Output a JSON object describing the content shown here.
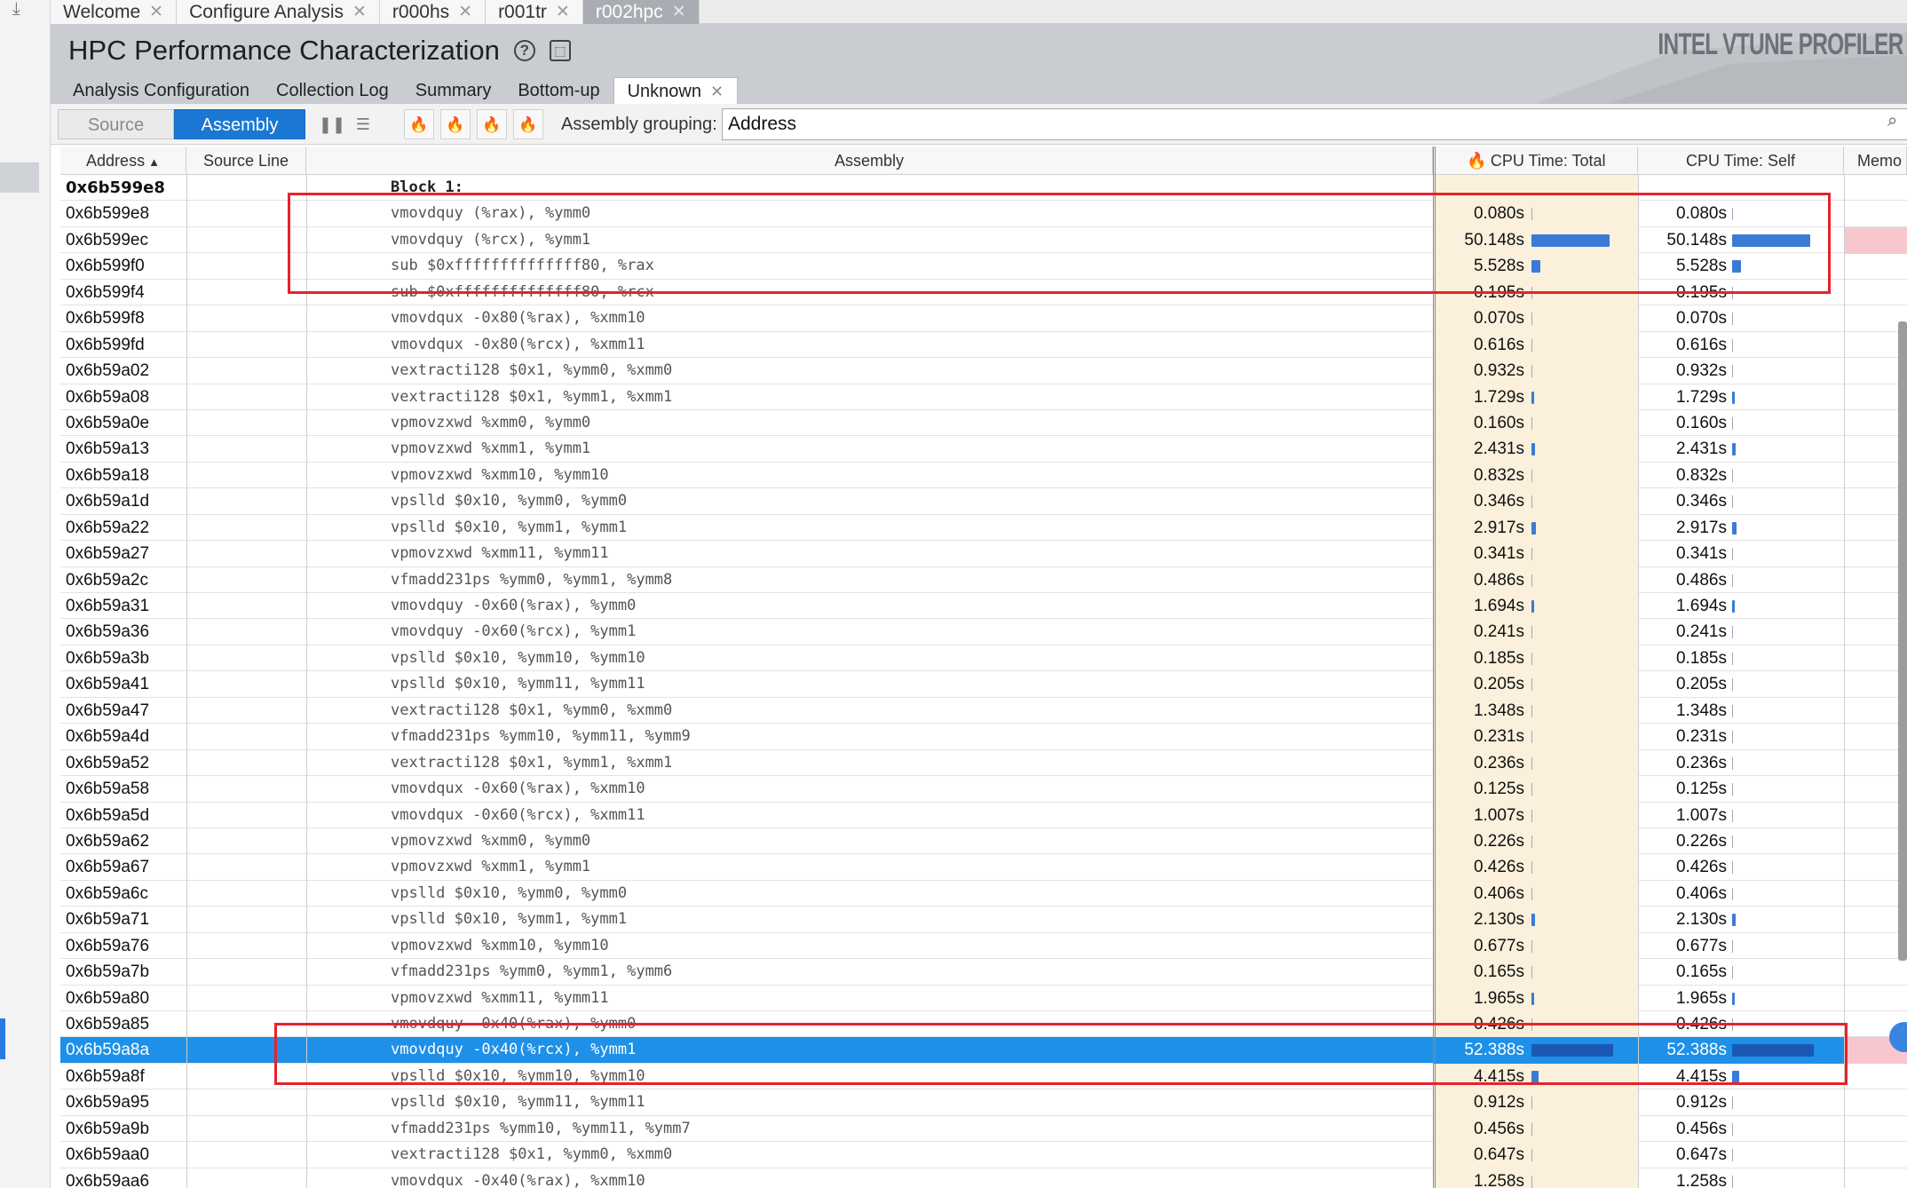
{
  "doc_tabs": [
    {
      "label": "Welcome",
      "active": false
    },
    {
      "label": "Configure Analysis",
      "active": false
    },
    {
      "label": "r000hs",
      "active": false
    },
    {
      "label": "r001tr",
      "active": false
    },
    {
      "label": "r002hpc",
      "active": true
    }
  ],
  "header": {
    "title": "HPC Performance Characterization",
    "brand": "INTEL VTUNE PROFILER"
  },
  "view_tabs": [
    {
      "label": "Analysis Configuration",
      "active": false
    },
    {
      "label": "Collection Log",
      "active": false
    },
    {
      "label": "Summary",
      "active": false
    },
    {
      "label": "Bottom-up",
      "active": false
    },
    {
      "label": "Unknown",
      "active": true
    }
  ],
  "toolbar": {
    "source_label": "Source",
    "assembly_label": "Assembly",
    "grouping_label": "Assembly grouping:",
    "grouping_value": "Address"
  },
  "columns": {
    "address": "Address",
    "source_line": "Source Line",
    "assembly": "Assembly",
    "cpu_total": "CPU Time: Total",
    "cpu_self": "CPU Time: Self",
    "memory": "Memo"
  },
  "rows": [
    {
      "addr": "0x6b599e8",
      "asm": "Block 1:",
      "total": "",
      "self": "",
      "block": true
    },
    {
      "addr": "0x6b599e8",
      "asm": "vmovdquy  (%rax), %ymm0",
      "total": "0.080s",
      "self": "0.080s",
      "ratio": 0.0015
    },
    {
      "addr": "0x6b599ec",
      "asm": "vmovdquy  (%rcx), %ymm1",
      "total": "50.148s",
      "self": "50.148s",
      "ratio": 0.957,
      "pink": true
    },
    {
      "addr": "0x6b599f0",
      "asm": "sub $0xffffffffffffff80, %rax",
      "total": "5.528s",
      "self": "5.528s",
      "ratio": 0.106
    },
    {
      "addr": "0x6b599f4",
      "asm": "sub $0xffffffffffffff80, %rcx",
      "total": "0.195s",
      "self": "0.195s",
      "ratio": 0.004
    },
    {
      "addr": "0x6b599f8",
      "asm": "vmovdqux  -0x80(%rax), %xmm10",
      "total": "0.070s",
      "self": "0.070s",
      "ratio": 0.0013
    },
    {
      "addr": "0x6b599fd",
      "asm": "vmovdqux  -0x80(%rcx), %xmm11",
      "total": "0.616s",
      "self": "0.616s",
      "ratio": 0.012
    },
    {
      "addr": "0x6b59a02",
      "asm": "vextracti128 $0x1, %ymm0, %xmm0",
      "total": "0.932s",
      "self": "0.932s",
      "ratio": 0.018
    },
    {
      "addr": "0x6b59a08",
      "asm": "vextracti128 $0x1, %ymm1, %xmm1",
      "total": "1.729s",
      "self": "1.729s",
      "ratio": 0.033
    },
    {
      "addr": "0x6b59a0e",
      "asm": "vpmovzxwd %xmm0, %ymm0",
      "total": "0.160s",
      "self": "0.160s",
      "ratio": 0.003
    },
    {
      "addr": "0x6b59a13",
      "asm": "vpmovzxwd %xmm1, %ymm1",
      "total": "2.431s",
      "self": "2.431s",
      "ratio": 0.046
    },
    {
      "addr": "0x6b59a18",
      "asm": "vpmovzxwd %xmm10, %ymm10",
      "total": "0.832s",
      "self": "0.832s",
      "ratio": 0.016
    },
    {
      "addr": "0x6b59a1d",
      "asm": "vpslld $0x10, %ymm0, %ymm0",
      "total": "0.346s",
      "self": "0.346s",
      "ratio": 0.0066
    },
    {
      "addr": "0x6b59a22",
      "asm": "vpslld $0x10, %ymm1, %ymm1",
      "total": "2.917s",
      "self": "2.917s",
      "ratio": 0.056
    },
    {
      "addr": "0x6b59a27",
      "asm": "vpmovzxwd %xmm11, %ymm11",
      "total": "0.341s",
      "self": "0.341s",
      "ratio": 0.0065
    },
    {
      "addr": "0x6b59a2c",
      "asm": "vfmadd231ps %ymm0, %ymm1, %ymm8",
      "total": "0.486s",
      "self": "0.486s",
      "ratio": 0.0093
    },
    {
      "addr": "0x6b59a31",
      "asm": "vmovdquy  -0x60(%rax), %ymm0",
      "total": "1.694s",
      "self": "1.694s",
      "ratio": 0.032
    },
    {
      "addr": "0x6b59a36",
      "asm": "vmovdquy  -0x60(%rcx), %ymm1",
      "total": "0.241s",
      "self": "0.241s",
      "ratio": 0.0046
    },
    {
      "addr": "0x6b59a3b",
      "asm": "vpslld $0x10, %ymm10, %ymm10",
      "total": "0.185s",
      "self": "0.185s",
      "ratio": 0.0035
    },
    {
      "addr": "0x6b59a41",
      "asm": "vpslld $0x10, %ymm11, %ymm11",
      "total": "0.205s",
      "self": "0.205s",
      "ratio": 0.0039
    },
    {
      "addr": "0x6b59a47",
      "asm": "vextracti128 $0x1, %ymm0, %xmm0",
      "total": "1.348s",
      "self": "1.348s",
      "ratio": 0.026
    },
    {
      "addr": "0x6b59a4d",
      "asm": "vfmadd231ps %ymm10, %ymm11, %ymm9",
      "total": "0.231s",
      "self": "0.231s",
      "ratio": 0.0044
    },
    {
      "addr": "0x6b59a52",
      "asm": "vextracti128 $0x1, %ymm1, %xmm1",
      "total": "0.236s",
      "self": "0.236s",
      "ratio": 0.0045
    },
    {
      "addr": "0x6b59a58",
      "asm": "vmovdqux  -0x60(%rax), %xmm10",
      "total": "0.125s",
      "self": "0.125s",
      "ratio": 0.0024
    },
    {
      "addr": "0x6b59a5d",
      "asm": "vmovdqux  -0x60(%rcx), %xmm11",
      "total": "1.007s",
      "self": "1.007s",
      "ratio": 0.019
    },
    {
      "addr": "0x6b59a62",
      "asm": "vpmovzxwd %xmm0, %ymm0",
      "total": "0.226s",
      "self": "0.226s",
      "ratio": 0.0043
    },
    {
      "addr": "0x6b59a67",
      "asm": "vpmovzxwd %xmm1, %ymm1",
      "total": "0.426s",
      "self": "0.426s",
      "ratio": 0.0081
    },
    {
      "addr": "0x6b59a6c",
      "asm": "vpslld $0x10, %ymm0, %ymm0",
      "total": "0.406s",
      "self": "0.406s",
      "ratio": 0.0078
    },
    {
      "addr": "0x6b59a71",
      "asm": "vpslld $0x10, %ymm1, %ymm1",
      "total": "2.130s",
      "self": "2.130s",
      "ratio": 0.041
    },
    {
      "addr": "0x6b59a76",
      "asm": "vpmovzxwd %xmm10, %ymm10",
      "total": "0.677s",
      "self": "0.677s",
      "ratio": 0.013
    },
    {
      "addr": "0x6b59a7b",
      "asm": "vfmadd231ps %ymm0, %ymm1, %ymm6",
      "total": "0.165s",
      "self": "0.165s",
      "ratio": 0.0031
    },
    {
      "addr": "0x6b59a80",
      "asm": "vpmovzxwd %xmm11, %ymm11",
      "total": "1.965s",
      "self": "1.965s",
      "ratio": 0.038
    },
    {
      "addr": "0x6b59a85",
      "asm": "vmovdquy  -0x40(%rax), %ymm0",
      "total": "0.426s",
      "self": "0.426s",
      "ratio": 0.0081
    },
    {
      "addr": "0x6b59a8a",
      "asm": "vmovdquy  -0x40(%rcx), %ymm1",
      "total": "52.388s",
      "self": "52.388s",
      "ratio": 1.0,
      "selected": true,
      "pink": true
    },
    {
      "addr": "0x6b59a8f",
      "asm": "vpslld $0x10, %ymm10, %ymm10",
      "total": "4.415s",
      "self": "4.415s",
      "ratio": 0.084
    },
    {
      "addr": "0x6b59a95",
      "asm": "vpslld $0x10, %ymm11, %ymm11",
      "total": "0.912s",
      "self": "0.912s",
      "ratio": 0.017
    },
    {
      "addr": "0x6b59a9b",
      "asm": "vfmadd231ps %ymm10, %ymm11, %ymm7",
      "total": "0.456s",
      "self": "0.456s",
      "ratio": 0.0087
    },
    {
      "addr": "0x6b59aa0",
      "asm": "vextracti128 $0x1, %ymm0, %xmm0",
      "total": "0.647s",
      "self": "0.647s",
      "ratio": 0.012
    },
    {
      "addr": "0x6b59aa6",
      "asm": "vmovdqux  -0x40(%rax), %xmm10",
      "total": "1.258s",
      "self": "1.258s",
      "ratio": 0.024
    }
  ],
  "colors": {
    "accent": "#1a78d4",
    "selection": "#1e90e8",
    "bar": "#3a7bd5",
    "annotation": "#e8222a",
    "total_column_bg": "#fbf0dc"
  }
}
